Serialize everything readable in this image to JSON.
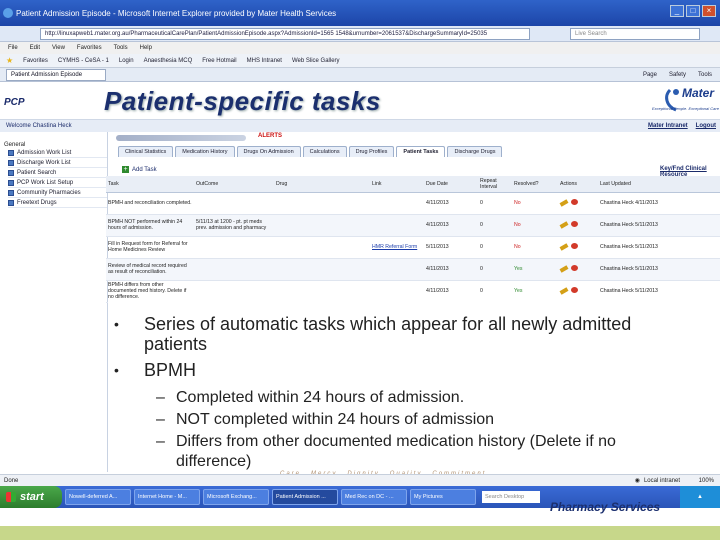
{
  "browser": {
    "title": "Patient Admission Episode - Microsoft Internet Explorer provided by Mater Health Services",
    "url": "http://linuxapweb1.mater.org.au/PharmaceuticalCarePlan/PatientAdmissionEpisode.aspx?AdmissionId=1565 1548&urnumber=2061537&DischargeSummaryId=25035",
    "search_placeholder": "Live Search",
    "menu": [
      "File",
      "Edit",
      "View",
      "Favorites",
      "Tools",
      "Help"
    ],
    "favorites_label": "Favorites",
    "favorites": [
      "CYMHS - CeSA - 1",
      "Login",
      "Anaesthesia MCQ",
      "Free Hotmail",
      "MHS Intranet",
      "Web Slice Gallery"
    ],
    "tab_label": "Patient Admission Episode",
    "tools": [
      "Page",
      "Safety",
      "Tools"
    ]
  },
  "page": {
    "pcp": "PCP",
    "slide_title": "Patient-specific tasks",
    "brand_name": "Mater",
    "brand_tagline": "Exceptional People. Exceptional Care",
    "welcome": "Welcome Chastina Heck",
    "header_links": [
      "Mater Intranet",
      "Logout"
    ],
    "alerts": "ALERTS"
  },
  "sidebar": {
    "section": "General",
    "items": [
      "Admission Work List",
      "Discharge Work List",
      "Patient Search",
      "PCP Work List Setup",
      "Community Pharmacies",
      "Freetext Drugs"
    ]
  },
  "nav_tabs": [
    "Clinical Statistics",
    "Medication History",
    "Drugs On Admission",
    "Calculations",
    "Drug Profiles",
    "Patient Tasks",
    "Discharge Drugs"
  ],
  "active_tab": "Patient Tasks",
  "tasks": {
    "add_label": "Add Task",
    "key_link": "Key/Fnd Clinical Resource",
    "columns": [
      "Task",
      "OutCome",
      "Drug",
      "Link",
      "Due Date",
      "Repeat Interval",
      "Resolved?",
      "Actions",
      "Last Updated"
    ],
    "rows": [
      {
        "task": "BPMH and reconciliation completed.",
        "outcome": "",
        "drug": "",
        "link": "",
        "due": "4/11/2013",
        "repeat": "0",
        "resolved": "No",
        "updated": "Chastina Heck 4/11/2013"
      },
      {
        "task": "BPMH NOT performed within 24 hours of admission.",
        "outcome": "5/11/13 at 1200 - pt. pt meds prev. admission and pharmacy",
        "drug": "",
        "link": "",
        "due": "4/11/2013",
        "repeat": "0",
        "resolved": "No",
        "updated": "Chastina Heck 5/11/2013"
      },
      {
        "task": "Fill in Request form for Referral for Home Medicines Review",
        "outcome": "",
        "drug": "",
        "link": "HMR Referral Form",
        "due": "5/11/2013",
        "repeat": "0",
        "resolved": "No",
        "updated": "Chastina Heck 5/11/2013"
      },
      {
        "task": "Review of medical record required as result of reconciliation.",
        "outcome": "",
        "drug": "",
        "link": "",
        "due": "4/11/2013",
        "repeat": "0",
        "resolved": "Yes",
        "updated": "Chastina Heck 5/11/2013"
      },
      {
        "task": "BPMH differs from other documented med history. Delete if no difference.",
        "outcome": "",
        "drug": "",
        "link": "",
        "due": "4/11/2013",
        "repeat": "0",
        "resolved": "Yes",
        "updated": "Chastina Heck 5/11/2013"
      }
    ]
  },
  "bullets": {
    "b1": "Series of automatic tasks which appear for all newly admitted",
    "b1_cont": "patients",
    "b2": "BPMH",
    "sub1": "Completed within 24 hours of admission.",
    "sub2": "NOT completed within 24 hours of admission",
    "sub3": "Differs from other documented medication history (Delete if no",
    "sub3_cont": "difference)"
  },
  "footer_values": [
    "Care",
    "Mercy",
    "Dignity",
    "Quality",
    "Commitment"
  ],
  "status": {
    "left": "Done",
    "zone": "Local intranet",
    "zoom": "100%"
  },
  "taskbar": {
    "start": "start",
    "items": [
      "Nowell-deferred A...",
      "Internet Home - M...",
      "Microsoft Exchang...",
      "Patient Admission ...",
      "Med Rec on DC - ...",
      "My Pictures"
    ],
    "search_placeholder": "Search Desktop"
  },
  "pharmacy_services": "Pharmacy Services"
}
